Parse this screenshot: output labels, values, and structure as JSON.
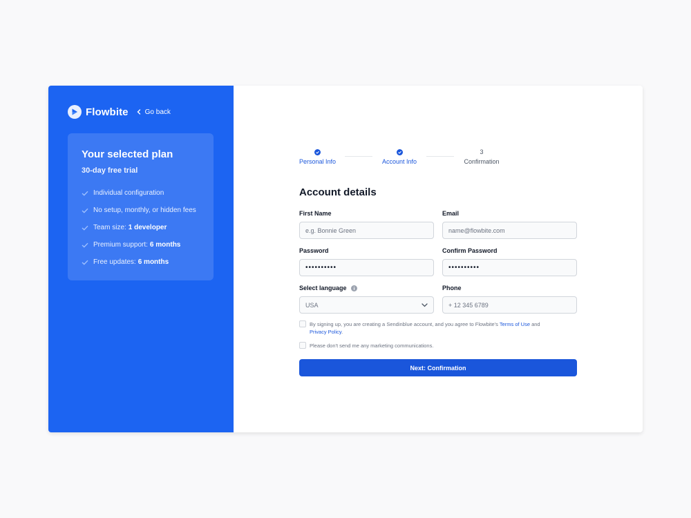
{
  "brand": {
    "name": "Flowbite",
    "go_back": "Go back"
  },
  "plan": {
    "title": "Your selected plan",
    "subtitle": "30-day free trial",
    "features": [
      {
        "text": "Individual configuration",
        "bold": ""
      },
      {
        "text": "No setup, monthly, or hidden fees",
        "bold": ""
      },
      {
        "text": "Team size:",
        "bold": "1 developer"
      },
      {
        "text": "Premium support:",
        "bold": "6 months"
      },
      {
        "text": "Free updates:",
        "bold": "6 months"
      }
    ]
  },
  "steps": [
    {
      "label": "Personal Info",
      "status": "done"
    },
    {
      "label": "Account Info",
      "status": "done"
    },
    {
      "label": "Confirmation",
      "status": "pending",
      "number": "3"
    }
  ],
  "form": {
    "title": "Account details",
    "first_name": {
      "label": "First Name",
      "placeholder": "e.g. Bonnie Green"
    },
    "email": {
      "label": "Email",
      "placeholder": "name@flowbite.com"
    },
    "password": {
      "label": "Password",
      "value": "••••••••••"
    },
    "confirm_password": {
      "label": "Confirm Password",
      "value": "••••••••••"
    },
    "language": {
      "label": "Select language",
      "value": "USA"
    },
    "phone": {
      "label": "Phone",
      "placeholder": "+ 12 345 6789"
    },
    "terms": {
      "text_before": "By signing up, you are creating a Sendinblue account, and you agree to Flowbite's",
      "terms_link": "Terms of Use",
      "and": "and",
      "privacy_link": "Privacy Policy",
      "period": "."
    },
    "marketing": "Please don't send me any marketing communications.",
    "submit": "Next: Confirmation"
  },
  "colors": {
    "primary": "#1c64f2",
    "button": "#1a56db",
    "background": "#f9f9fa"
  },
  "icons": {
    "logo": "flowbite-logo",
    "back": "chevron-left-icon",
    "check": "check-icon",
    "step_done": "check-circle-icon",
    "info": "info-icon",
    "dropdown": "chevron-down-icon"
  }
}
